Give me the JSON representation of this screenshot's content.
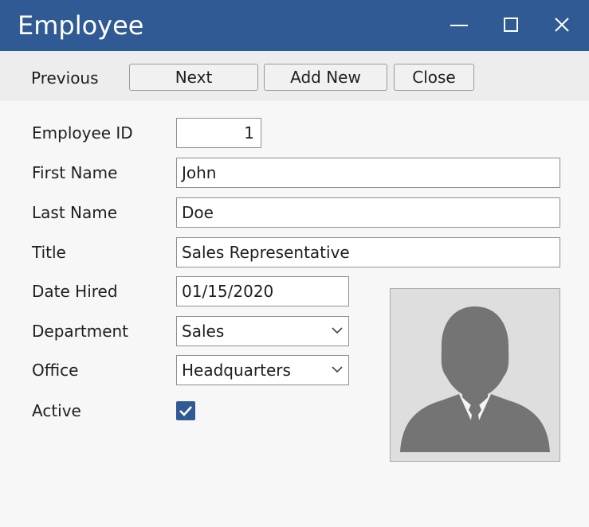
{
  "window": {
    "title": "Employee"
  },
  "toolbar": {
    "previous_label": "Previous",
    "next_label": "Next",
    "add_new_label": "Add New",
    "close_label": "Close"
  },
  "form": {
    "employee_id": {
      "label": "Employee ID",
      "value": "1"
    },
    "first_name": {
      "label": "First Name",
      "value": "John"
    },
    "last_name": {
      "label": "Last Name",
      "value": "Doe"
    },
    "title": {
      "label": "Title",
      "value": "Sales Representative"
    },
    "date_hired": {
      "label": "Date Hired",
      "value": "01/15/2020"
    },
    "department": {
      "label": "Department",
      "value": "Sales"
    },
    "office": {
      "label": "Office",
      "value": "Headquarters"
    },
    "active": {
      "label": "Active",
      "checked": true
    }
  },
  "colors": {
    "titlebar": "#2f5a94",
    "checkbox": "#2f5a94",
    "avatar": "#747474"
  },
  "icons": [
    "minimize-icon",
    "maximize-icon",
    "close-icon",
    "chevron-down-icon",
    "checkmark-icon",
    "person-silhouette-icon"
  ]
}
